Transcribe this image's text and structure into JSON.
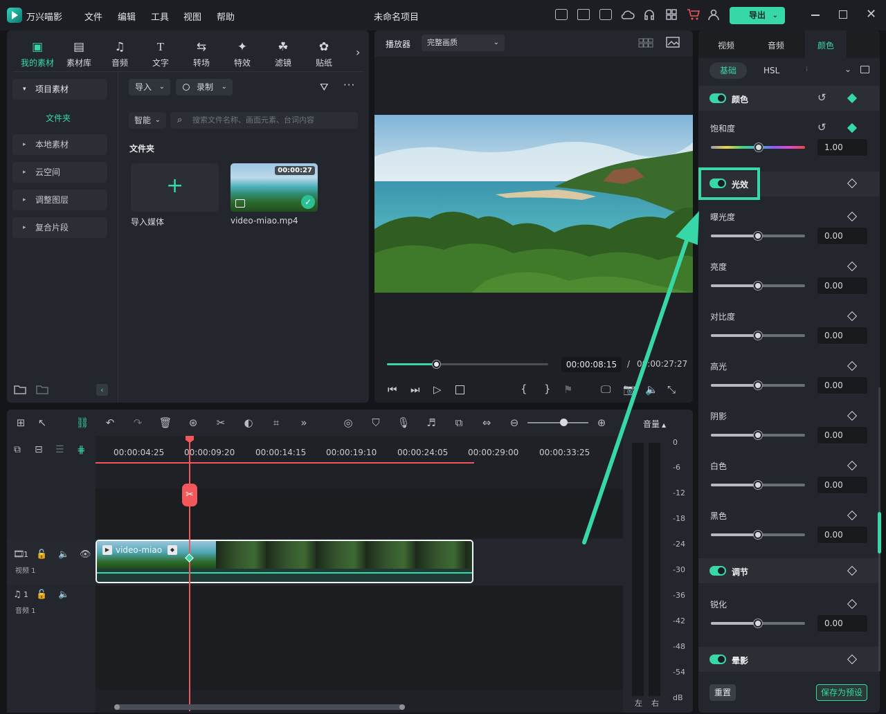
{
  "app": {
    "name": "万兴喵影",
    "project_title": "未命名项目"
  },
  "menu": [
    "文件",
    "编辑",
    "工具",
    "视图",
    "帮助"
  ],
  "title_icons": [
    "media-manager-icon",
    "layout-icon",
    "save-icon",
    "cloud-icon",
    "headset-icon",
    "grid-apps-icon",
    "cart-icon",
    "user-icon"
  ],
  "export_label": "导出",
  "toolbar": [
    "我的素材",
    "素材库",
    "音频",
    "文字",
    "转场",
    "特效",
    "滤镜",
    "贴纸"
  ],
  "sidebar": {
    "project_media": "项目素材",
    "folder": "文件夹",
    "items": [
      "本地素材",
      "云空间",
      "调整图层",
      "复合片段"
    ]
  },
  "media": {
    "import_label": "导入",
    "record_label": "录制",
    "smart_label": "智能",
    "search_placeholder": "搜索文件名称、画面元素、台词内容",
    "section_title": "文件夹",
    "import_tile_label": "导入媒体",
    "clip_name": "video-miao.mp4",
    "clip_duration": "00:00:27"
  },
  "player": {
    "label": "播放器",
    "quality": "完整画质",
    "current_time": "00:00:08:15",
    "separator": "/",
    "total_time": "00:00:27:27",
    "progress": 0.31,
    "brace_open": "{",
    "brace_close": "}"
  },
  "timeline": {
    "ruler": [
      "00:00:04:25",
      "00:00:09:20",
      "00:00:14:15",
      "00:00:19:10",
      "00:00:24:05",
      "00:00:29:00",
      "00:00:33:25"
    ],
    "video_track_number": "1",
    "video_track_name": "视频 1",
    "audio_track_number": "1",
    "audio_track_name": "音频 1",
    "clip_label": "video-miao",
    "zoom_level": 0.6
  },
  "volume": {
    "title": "音量",
    "scale": [
      "0",
      "-6",
      "-12",
      "-18",
      "-24",
      "-30",
      "-36",
      "-42",
      "-48",
      "-54",
      "dB"
    ],
    "left": "左",
    "right": "右"
  },
  "right_panel": {
    "tabs": [
      "视频",
      "音频",
      "颜色"
    ],
    "active_tab": "颜色",
    "subtabs": [
      "基础",
      "HSL"
    ],
    "color_section": "颜色",
    "saturation": {
      "label": "饱和度",
      "value": "1.00"
    },
    "light_section": "光效",
    "light_params": [
      {
        "label": "曝光度",
        "value": "0.00"
      },
      {
        "label": "亮度",
        "value": "0.00"
      },
      {
        "label": "对比度",
        "value": "0.00"
      },
      {
        "label": "高光",
        "value": "0.00"
      },
      {
        "label": "阴影",
        "value": "0.00"
      },
      {
        "label": "白色",
        "value": "0.00"
      },
      {
        "label": "黑色",
        "value": "0.00"
      }
    ],
    "adjust_section": "调节",
    "sharpen": {
      "label": "锐化",
      "value": "0.00"
    },
    "vignette_section": "晕影",
    "reset_label": "重置",
    "save_preset_label": "保存为预设"
  },
  "colors": {
    "accent": "#37d7a8",
    "playhead": "#f2575b",
    "highlight_box": "#37d7a8"
  }
}
